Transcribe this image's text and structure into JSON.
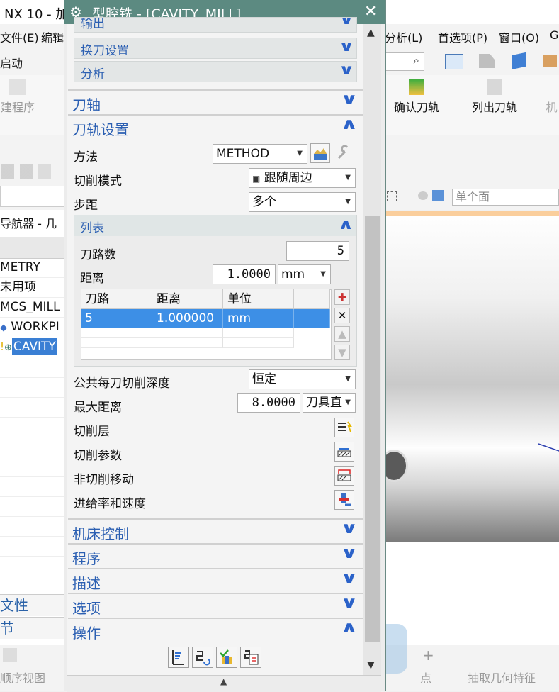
{
  "app": {
    "title": "NX 10 - 加",
    "menu": [
      "文件(E)",
      "编辑",
      "分析(L)",
      "首选项(P)",
      "窗口(O)",
      "G"
    ],
    "toolbar_start": "启动",
    "ribbon": {
      "create_program": "建程序",
      "verify": "确认刀轨",
      "list": "列出刀轨",
      "machine": "机"
    },
    "view_filter": "单个面",
    "navigator": {
      "title": "导航器 - 几",
      "rows": [
        "METRY",
        "未用项",
        "MCS_MILL",
        "WORKPI",
        "CAVITY"
      ],
      "tab1": "文性",
      "tab2": "节"
    },
    "bottom": {
      "seq_view": "顺序视图",
      "point": "点",
      "extract": "抽取几何特征"
    }
  },
  "dialog": {
    "title": "型腔铣 - [CAVITY_MILL]",
    "sub_top": [
      "输出",
      "换刀设置",
      "分析"
    ],
    "sections": {
      "tool_axis": "刀轴",
      "path_settings": "刀轨设置",
      "machine_control": "机床控制",
      "program": "程序",
      "description": "描述",
      "options": "选项",
      "actions": "操作"
    },
    "method_label": "方法",
    "method_value": "METHOD",
    "cut_pattern_label": "切削模式",
    "cut_pattern_value": "跟随周边",
    "stepover_label": "步距",
    "stepover_value": "多个",
    "list": {
      "title": "列表",
      "passes_label": "刀路数",
      "passes_value": "5",
      "distance_label": "距离",
      "distance_value": "1.0000",
      "distance_unit": "mm",
      "columns": [
        "刀路",
        "距离",
        "单位"
      ],
      "rows": [
        [
          "5",
          "1.000000",
          "mm"
        ]
      ]
    },
    "common_depth_label": "公共每刀切削深度",
    "common_depth_value": "恒定",
    "max_distance_label": "最大距离",
    "max_distance_value": "8.0000",
    "max_distance_unit": "刀具直",
    "cut_levels": "切削层",
    "cut_params": "切削参数",
    "non_cut": "非切削移动",
    "feeds": "进给率和速度"
  }
}
